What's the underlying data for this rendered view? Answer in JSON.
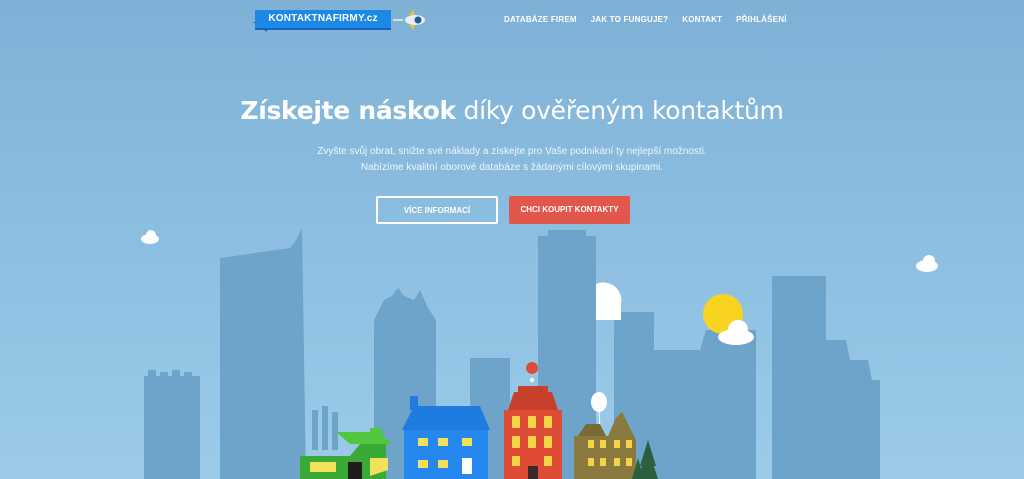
{
  "logo": {
    "text": "KONTAKTNAFIRMY.cz"
  },
  "nav": [
    {
      "label": "DATABÁZE FIREM"
    },
    {
      "label": "JAK TO FUNGUJE?"
    },
    {
      "label": "KONTAKT"
    },
    {
      "label": "PŘIHLÁŠENÍ"
    }
  ],
  "hero": {
    "title_bold": "Získejte náskok",
    "title_rest": " díky ověřeným kontaktům",
    "line1": "Zvyšte svůj obrat, snižte své náklady a získejte pro Vaše podnikání ty nejlepší možnosti.",
    "line2": "Nabízíme kvalitní oborové databáze s žádanými cílovými skupinami."
  },
  "buttons": {
    "more_info": "VÍCE INFORMACÍ",
    "buy": "CHCI KOUPIT KONTAKTY"
  },
  "colors": {
    "sky": "#8bbde0",
    "buildings": "#6ea3c9",
    "red_button": "#e2574c",
    "logo_blue": "#1e88e5",
    "sun": "#f8d320"
  }
}
